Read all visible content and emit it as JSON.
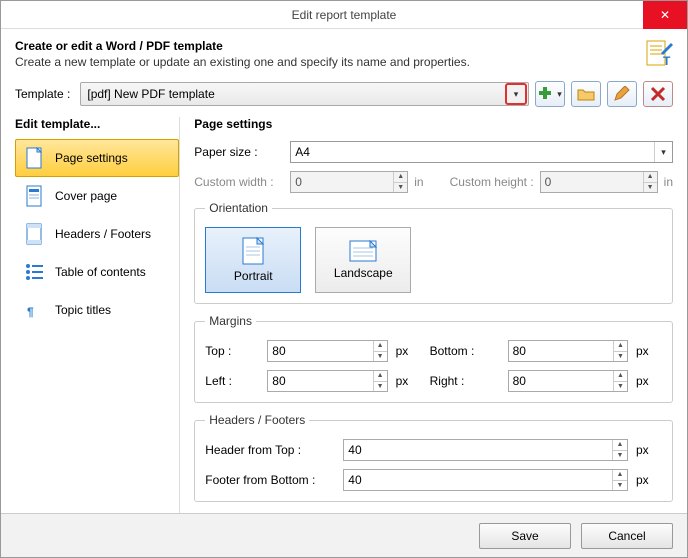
{
  "window": {
    "title": "Edit report template"
  },
  "header": {
    "title": "Create or edit a Word / PDF template",
    "subtitle": "Create a new template or update an existing one and specify its name and properties."
  },
  "template": {
    "label": "Template :",
    "value": "[pdf] New PDF template"
  },
  "sidebar": {
    "heading": "Edit template...",
    "items": [
      {
        "label": "Page settings"
      },
      {
        "label": "Cover page"
      },
      {
        "label": "Headers / Footers"
      },
      {
        "label": "Table of contents"
      },
      {
        "label": "Topic titles"
      }
    ]
  },
  "page_settings": {
    "heading": "Page settings",
    "paper_size_label": "Paper size :",
    "paper_size_value": "A4",
    "custom_width_label": "Custom width :",
    "custom_width_value": "0",
    "custom_height_label": "Custom height :",
    "custom_height_value": "0",
    "unit_in": "in",
    "orientation_legend": "Orientation",
    "portrait_label": "Portrait",
    "landscape_label": "Landscape",
    "margins_legend": "Margins",
    "top_label": "Top :",
    "top_value": "80",
    "bottom_label": "Bottom :",
    "bottom_value": "80",
    "left_label": "Left :",
    "left_value": "80",
    "right_label": "Right :",
    "right_value": "80",
    "px": "px",
    "hf_legend": "Headers / Footers",
    "header_from_top_label": "Header from Top :",
    "header_from_top_value": "40",
    "footer_from_bottom_label": "Footer from Bottom :",
    "footer_from_bottom_value": "40"
  },
  "footer": {
    "save": "Save",
    "cancel": "Cancel"
  }
}
